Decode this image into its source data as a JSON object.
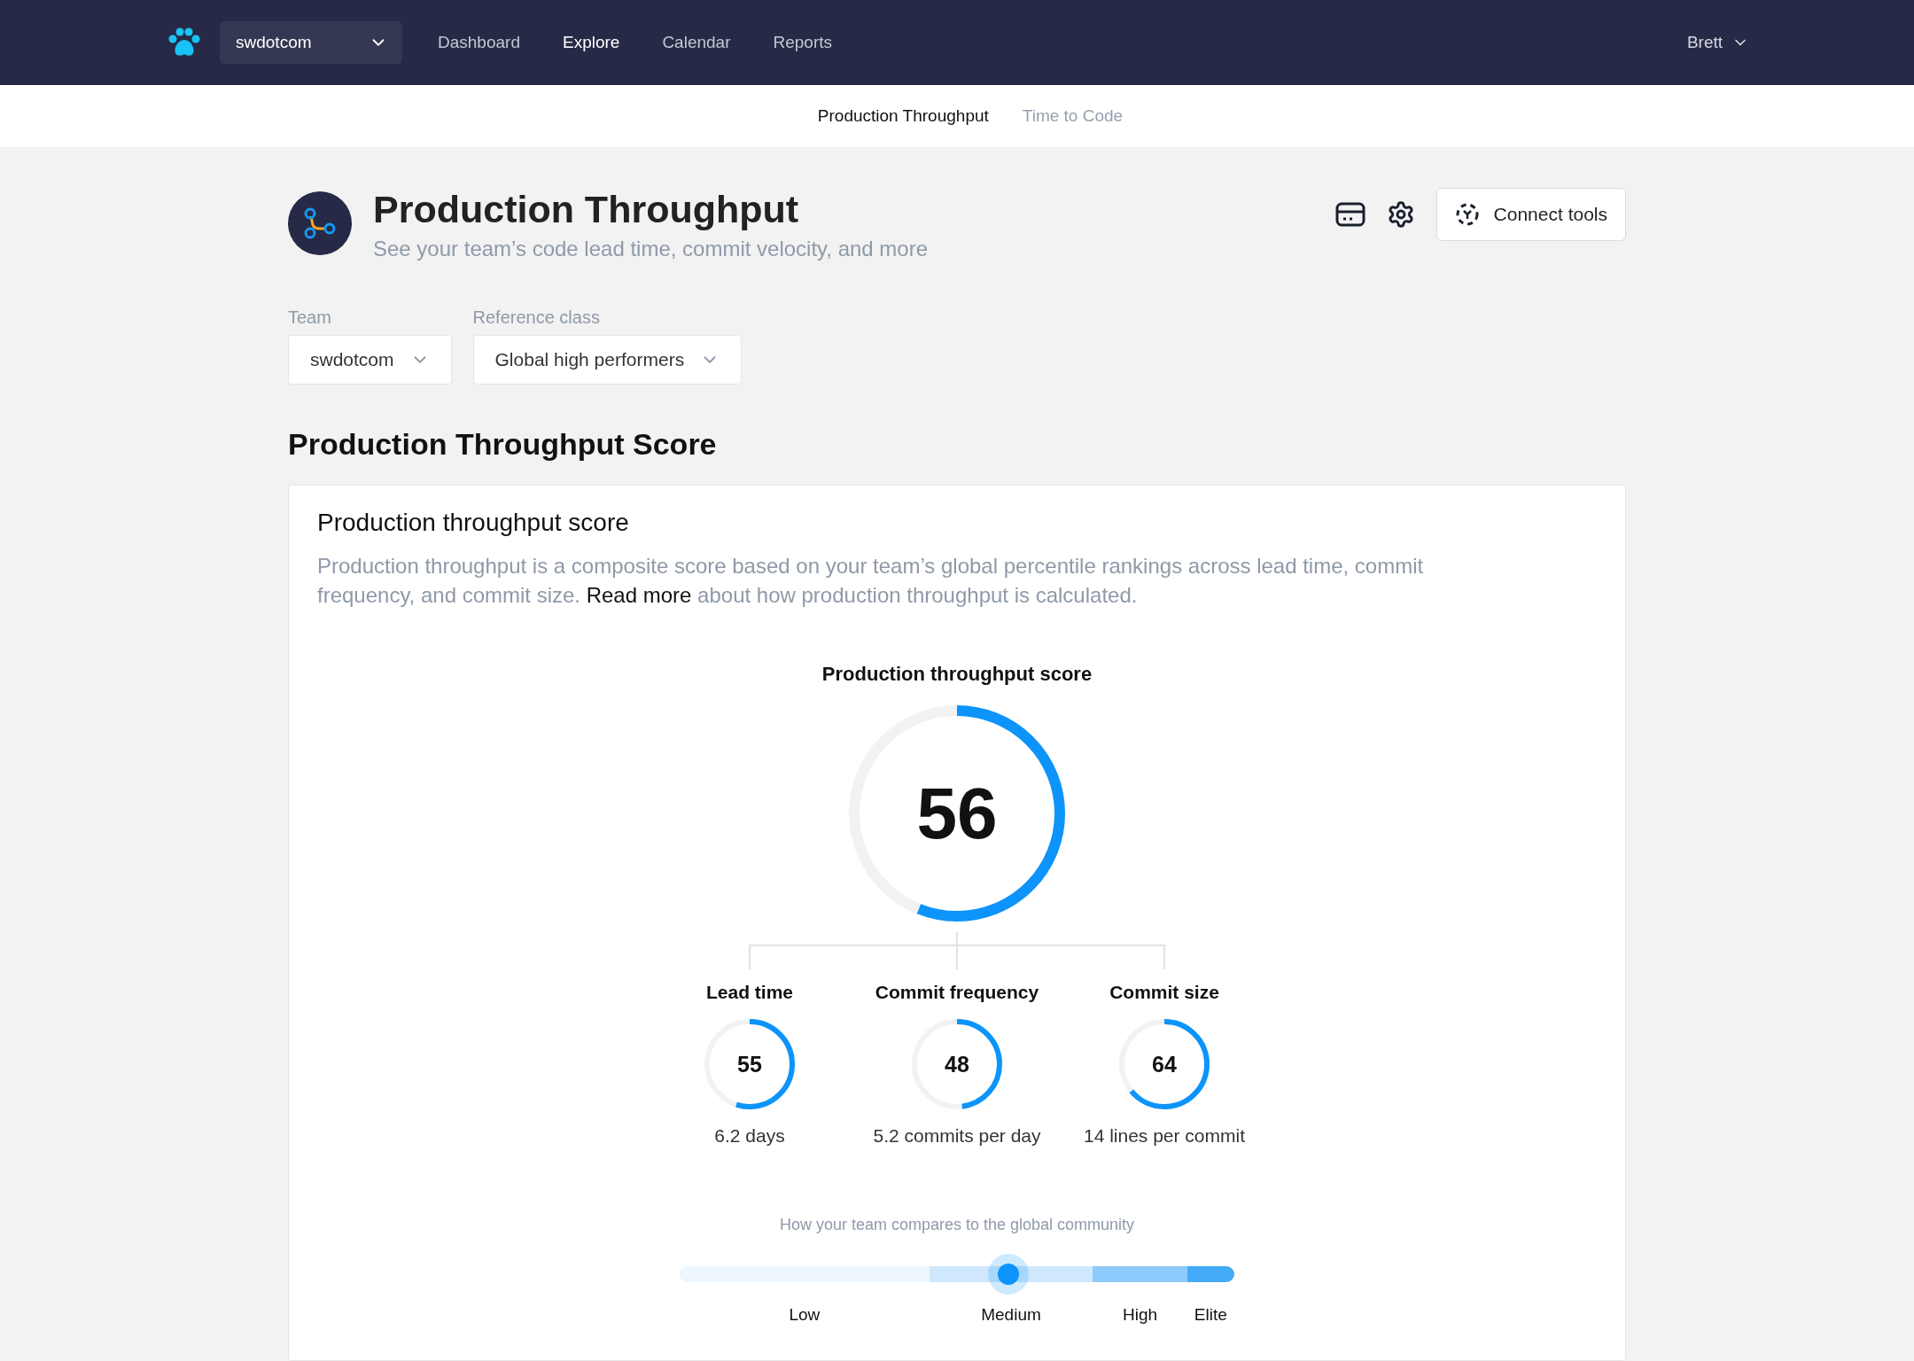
{
  "top_nav": {
    "workspace": "swdotcom",
    "links": [
      {
        "label": "Dashboard",
        "selected": false
      },
      {
        "label": "Explore",
        "selected": true
      },
      {
        "label": "Calendar",
        "selected": false
      },
      {
        "label": "Reports",
        "selected": false
      }
    ],
    "user": "Brett"
  },
  "sub_tabs": [
    {
      "label": "Production Throughput",
      "selected": true
    },
    {
      "label": "Time to Code",
      "selected": false
    }
  ],
  "header": {
    "title": "Production Throughput",
    "subtitle": "See your team’s code lead time, commit velocity, and more",
    "connect_button": "Connect tools"
  },
  "filters": [
    {
      "label": "Team",
      "value": "swdotcom"
    },
    {
      "label": "Reference class",
      "value": "Global high performers"
    }
  ],
  "section_title": "Production Throughput Score",
  "card": {
    "title": "Production throughput score",
    "description_before": "Production throughput is a composite score based on your team’s global percentile rankings across lead time, commit frequency, and commit size.",
    "link": "Read more",
    "description_after": "about how production throughput is calculated.",
    "main_score": {
      "title": "Production throughput score",
      "value": "56",
      "level": 0.56
    },
    "metrics": [
      {
        "title": "Lead time",
        "value": "55",
        "level": 0.55,
        "reading": "6.2 days"
      },
      {
        "title": "Commit frequency",
        "value": "48",
        "level": 0.48,
        "reading": "5.2 commits per day"
      },
      {
        "title": "Commit size",
        "value": "64",
        "level": 0.64,
        "reading": "14 lines per commit"
      }
    ],
    "comparison": {
      "caption": "How your team compares to the global community",
      "level": 0.6,
      "segments": [
        {
          "label": "Low",
          "color": "#eff7fe"
        },
        {
          "label": "Medium",
          "color": "#cfe8fd"
        },
        {
          "label": "High",
          "color": "#8ccbfb"
        },
        {
          "label": "Elite",
          "color": "#44acf8"
        }
      ]
    }
  }
}
